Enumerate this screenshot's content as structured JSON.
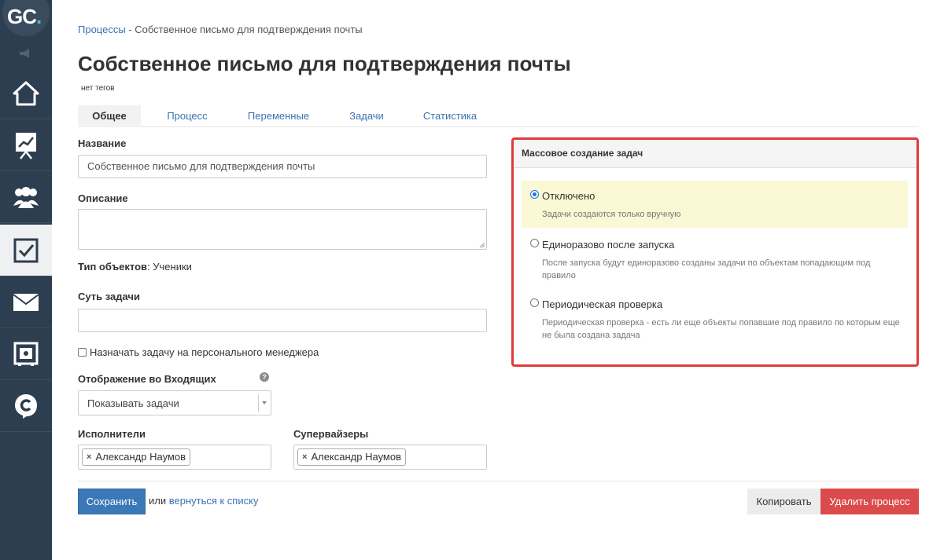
{
  "sidebar": {
    "logo_text": "GC",
    "logo_dot": ".",
    "items": [
      {
        "icon": "home-icon"
      },
      {
        "icon": "chart-icon"
      },
      {
        "icon": "users-icon"
      },
      {
        "icon": "tasks-icon",
        "active": true
      },
      {
        "icon": "mail-icon"
      },
      {
        "icon": "safe-icon"
      },
      {
        "icon": "chat-icon"
      }
    ]
  },
  "breadcrumb": {
    "parent": "Процессы",
    "separator": " - ",
    "current": "Собственное письмо для подтверждения почты"
  },
  "page": {
    "title": "Собственное письмо для подтверждения почты",
    "tags": "нет тегов"
  },
  "tabs": [
    {
      "label": "Общее",
      "active": true
    },
    {
      "label": "Процесс"
    },
    {
      "label": "Переменные"
    },
    {
      "label": "Задачи"
    },
    {
      "label": "Статистика"
    }
  ],
  "form": {
    "name_label": "Название",
    "name_value": "Собственное письмо для подтверждения почты",
    "description_label": "Описание",
    "object_type_label": "Тип объектов",
    "object_type_value": ": Ученики",
    "task_essence_label": "Суть задачи",
    "assign_manager_label": "Назначать задачу на персонального менеджера",
    "inbox_display_label": "Отображение во Входящих",
    "inbox_display_value": "Показывать задачи",
    "help_glyph": "?",
    "executors_label": "Исполнители",
    "executors": [
      "Александр Наумов"
    ],
    "supervisors_label": "Супервайзеры",
    "supervisors": [
      "Александр Наумов"
    ]
  },
  "actions": {
    "save_label": "Сохранить",
    "or_text": "или",
    "back_link": "вернуться к списку",
    "copy_label": "Копировать",
    "delete_label": "Удалить процесс"
  },
  "mass_creation": {
    "title": "Массовое создание задач",
    "options": [
      {
        "label": "Отключено",
        "description": "Задачи создаются только вручную",
        "selected": true
      },
      {
        "label": "Единоразово после запуска",
        "description": "После запуска будут единоразово созданы задачи по объектам попадающим под правило"
      },
      {
        "label": "Периодическая проверка",
        "description": "Периодическая проверка - есть ли еще объекты попавшие под правило по которым еще не была создана задача"
      }
    ]
  },
  "colors": {
    "sidebar_bg": "#2d3e50",
    "link": "#3b73af",
    "primary": "#3b78b8",
    "danger": "#dc4b4b",
    "highlight_border": "#e03a3a",
    "selected_option_bg": "#fbf8d5"
  }
}
